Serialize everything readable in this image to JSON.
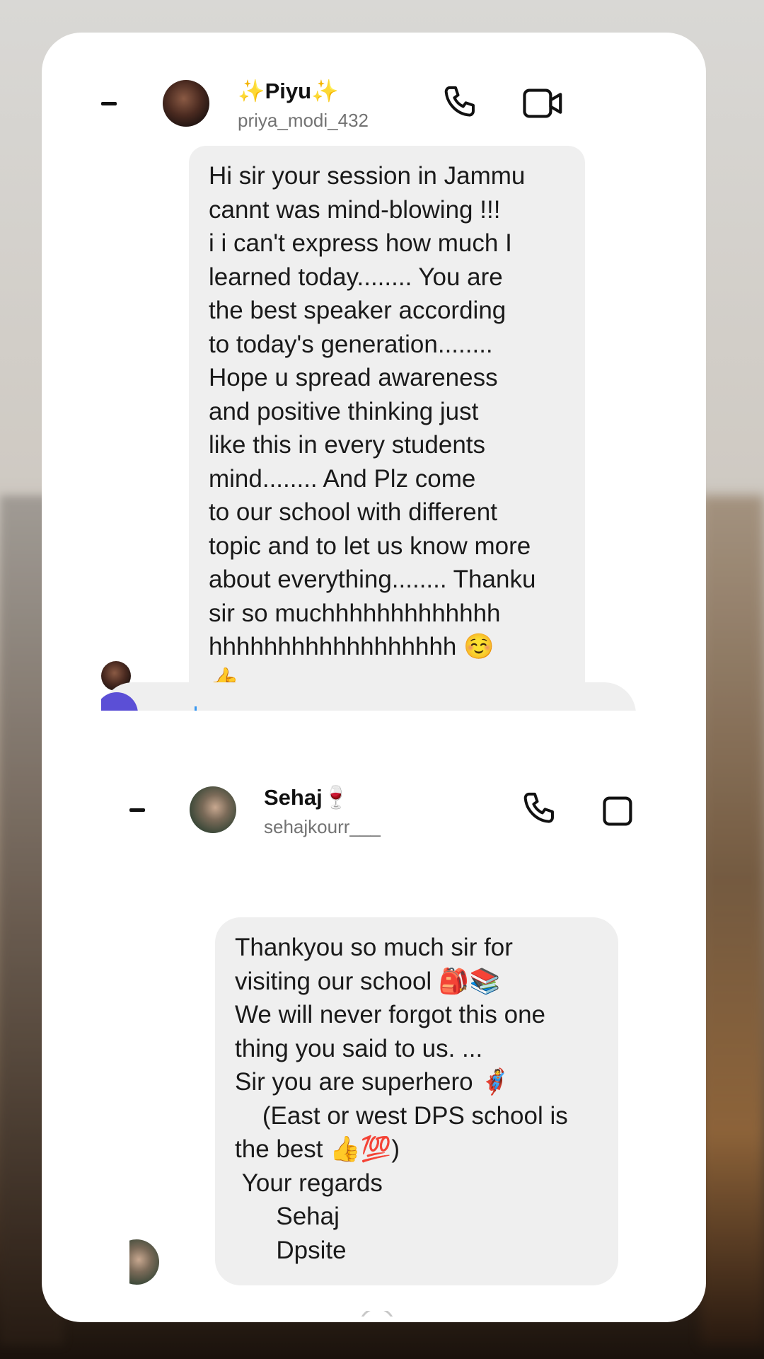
{
  "conversations": [
    {
      "display_name": "✨Piyu✨",
      "username": "priya_modi_432",
      "message": "Hi sir your session in Jammu\ncannt was mind-blowing !!!\ni i can't express how much I\nlearned today........ You are\nthe best speaker according\nto today's generation........\nHope u spread awareness\nand positive thinking just\nlike this in every students\nmind........ And Plz come\nto our school with different\ntopic and to let us know more\nabout everything........ Thanku\nsir so muchhhhhhhhhhhhh\nhhhhhhhhhhhhhhhhhh ☺️\n👍"
    },
    {
      "display_name": "Sehaj🍷",
      "username": "sehajkourr___",
      "message": "Thankyou so much sir for\nvisiting our school 🎒📚\nWe will never forgot this one\nthing you said to us. ...\nSir you are superhero 🦸\n    (East or west DPS school is\nthe best 👍💯)\n Your regards\n      Sehaj\n      Dpsite"
    }
  ],
  "icons": {
    "back": "back-dash-icon",
    "call": "phone-icon",
    "video": "video-camera-icon",
    "composer_camera": "camera-icon"
  },
  "colors": {
    "bubble": "#efefef",
    "username": "#737373",
    "cursor": "#3797f0",
    "camera_button": "#5b4fd6"
  }
}
